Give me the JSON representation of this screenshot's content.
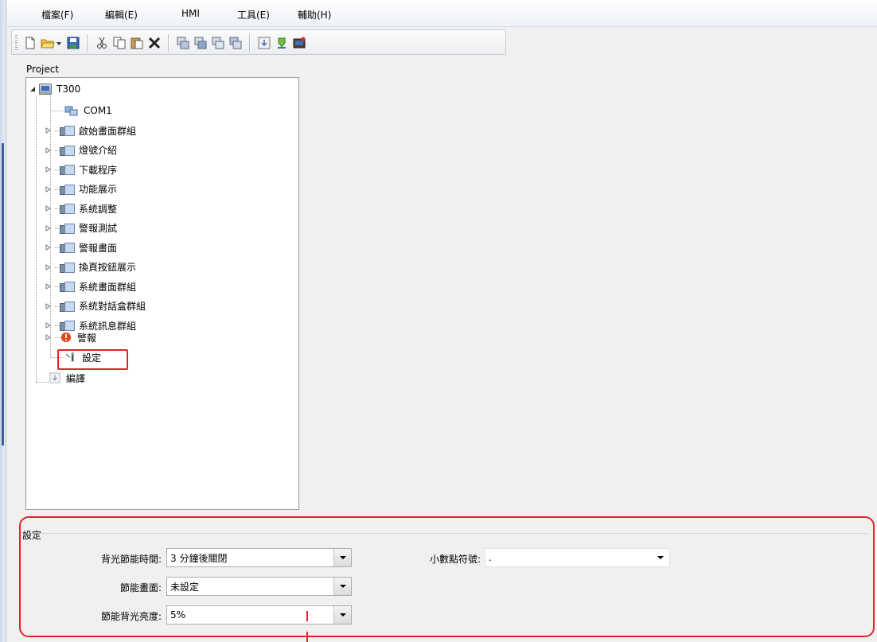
{
  "menu": [
    "檔案(F)",
    "編輯(E)",
    "HMI",
    "工具(E)",
    "輔助(H)"
  ],
  "toolbar": {
    "icons": [
      "new-file-icon",
      "open-folder-icon",
      "dropdown-arrow-icon",
      "save-icon",
      "cut-icon",
      "copy-icon",
      "paste-icon",
      "delete-icon",
      "screen-copy-icon",
      "screen-paste-icon",
      "screen-cut-icon",
      "screen-duplicate-icon",
      "compile-icon",
      "download-icon",
      "simulate-icon"
    ]
  },
  "project": {
    "label": "Project",
    "root": "T300",
    "comm": "COM1",
    "groups": [
      "啟始畫面群組",
      "燈號介紹",
      "下載程序",
      "功能展示",
      "系統調整",
      "警報測試",
      "警報畫面",
      "換頁按鈕展示",
      "系統畫面群組",
      "系統對話盒群組",
      "系統訊息群組"
    ],
    "alarm": "警報",
    "settings": "設定",
    "compile": "編譯"
  },
  "settings_panel": {
    "title": "設定",
    "backlight_time_label": "背光節能時間:",
    "backlight_time_value": "3 分鐘後關閉",
    "saver_screen_label": "節能畫面:",
    "saver_screen_value": "未設定",
    "saver_brightness_label": "節能背光亮度:",
    "saver_brightness_value": "5%",
    "decimal_label": "小數點符號:",
    "decimal_value": "."
  },
  "colors": {
    "highlight": "#e0262b",
    "tree_background": "#ffffff",
    "window_background": "#f0f0f0"
  }
}
